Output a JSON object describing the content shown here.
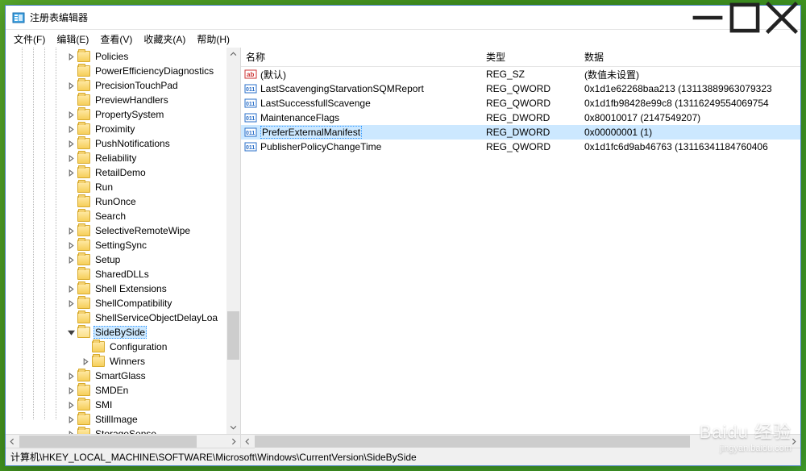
{
  "title": "注册表编辑器",
  "menu": {
    "file": "文件(F)",
    "edit": "编辑(E)",
    "view": "查看(V)",
    "favorites": "收藏夹(A)",
    "help": "帮助(H)"
  },
  "columns": {
    "name": "名称",
    "type": "类型",
    "data": "数据"
  },
  "tree": [
    {
      "label": "Policies",
      "depth": 5,
      "exp": "closed"
    },
    {
      "label": "PowerEfficiencyDiagnostics",
      "depth": 5,
      "exp": "none"
    },
    {
      "label": "PrecisionTouchPad",
      "depth": 5,
      "exp": "closed"
    },
    {
      "label": "PreviewHandlers",
      "depth": 5,
      "exp": "none"
    },
    {
      "label": "PropertySystem",
      "depth": 5,
      "exp": "closed"
    },
    {
      "label": "Proximity",
      "depth": 5,
      "exp": "closed"
    },
    {
      "label": "PushNotifications",
      "depth": 5,
      "exp": "closed"
    },
    {
      "label": "Reliability",
      "depth": 5,
      "exp": "closed"
    },
    {
      "label": "RetailDemo",
      "depth": 5,
      "exp": "closed"
    },
    {
      "label": "Run",
      "depth": 5,
      "exp": "none"
    },
    {
      "label": "RunOnce",
      "depth": 5,
      "exp": "none"
    },
    {
      "label": "Search",
      "depth": 5,
      "exp": "none"
    },
    {
      "label": "SelectiveRemoteWipe",
      "depth": 5,
      "exp": "closed"
    },
    {
      "label": "SettingSync",
      "depth": 5,
      "exp": "closed"
    },
    {
      "label": "Setup",
      "depth": 5,
      "exp": "closed"
    },
    {
      "label": "SharedDLLs",
      "depth": 5,
      "exp": "none"
    },
    {
      "label": "Shell Extensions",
      "depth": 5,
      "exp": "closed"
    },
    {
      "label": "ShellCompatibility",
      "depth": 5,
      "exp": "closed"
    },
    {
      "label": "ShellServiceObjectDelayLoa",
      "depth": 5,
      "exp": "none"
    },
    {
      "label": "SideBySide",
      "depth": 5,
      "exp": "open",
      "selected": true
    },
    {
      "label": "Configuration",
      "depth": 6,
      "exp": "none"
    },
    {
      "label": "Winners",
      "depth": 6,
      "exp": "closed"
    },
    {
      "label": "SmartGlass",
      "depth": 5,
      "exp": "closed"
    },
    {
      "label": "SMDEn",
      "depth": 5,
      "exp": "closed"
    },
    {
      "label": "SMI",
      "depth": 5,
      "exp": "closed"
    },
    {
      "label": "StillImage",
      "depth": 5,
      "exp": "closed"
    },
    {
      "label": "StorageSense",
      "depth": 5,
      "exp": "closed"
    }
  ],
  "values": [
    {
      "name": "(默认)",
      "type": "REG_SZ",
      "data": "(数值未设置)",
      "icon": "str"
    },
    {
      "name": "LastScavengingStarvationSQMReport",
      "type": "REG_QWORD",
      "data": "0x1d1e62268baa213 (13113889963079323",
      "icon": "bin"
    },
    {
      "name": "LastSuccessfullScavenge",
      "type": "REG_QWORD",
      "data": "0x1d1fb98428e99c8 (13116249554069754",
      "icon": "bin"
    },
    {
      "name": "MaintenanceFlags",
      "type": "REG_DWORD",
      "data": "0x80010017 (2147549207)",
      "icon": "bin"
    },
    {
      "name": "PreferExternalManifest",
      "type": "REG_DWORD",
      "data": "0x00000001 (1)",
      "icon": "bin",
      "selected": true
    },
    {
      "name": "PublisherPolicyChangeTime",
      "type": "REG_QWORD",
      "data": "0x1d1fc6d9ab46763 (13116341184760406",
      "icon": "bin"
    }
  ],
  "statusbar": "计算机\\HKEY_LOCAL_MACHINE\\SOFTWARE\\Microsoft\\Windows\\CurrentVersion\\SideBySide",
  "watermark": {
    "brand": "Baidu 经验",
    "url": "jingyan.baidu.com"
  }
}
